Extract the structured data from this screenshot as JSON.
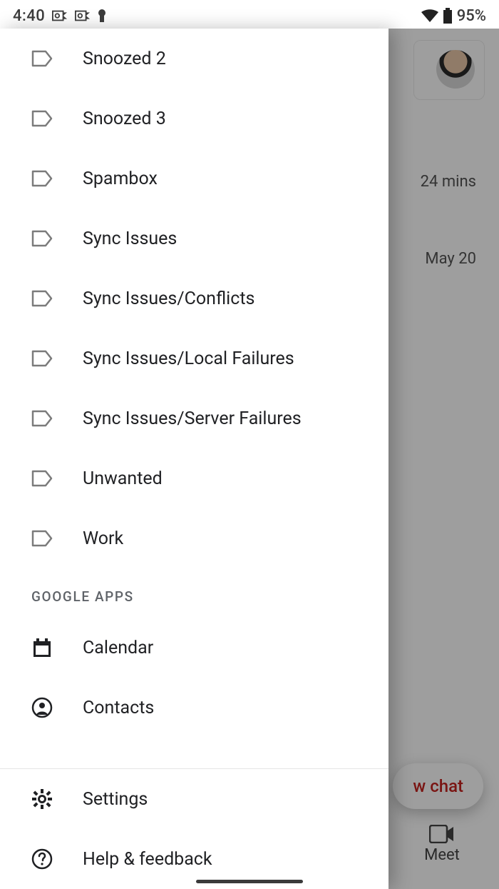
{
  "status": {
    "time": "4:40",
    "battery": "95%"
  },
  "drawer": {
    "labels": [
      "Snoozed 2",
      "Snoozed 3",
      "Spambox",
      "Sync Issues",
      "Sync Issues/Conflicts",
      "Sync Issues/Local Failures",
      "Sync Issues/Server Failures",
      "Unwanted",
      "Work"
    ],
    "section_google_apps": "GOOGLE APPS",
    "calendar": "Calendar",
    "contacts": "Contacts",
    "settings": "Settings",
    "help": "Help & feedback"
  },
  "background": {
    "time1": "24 mins",
    "time2": "May 20",
    "fab": "w chat",
    "meet": "Meet"
  }
}
